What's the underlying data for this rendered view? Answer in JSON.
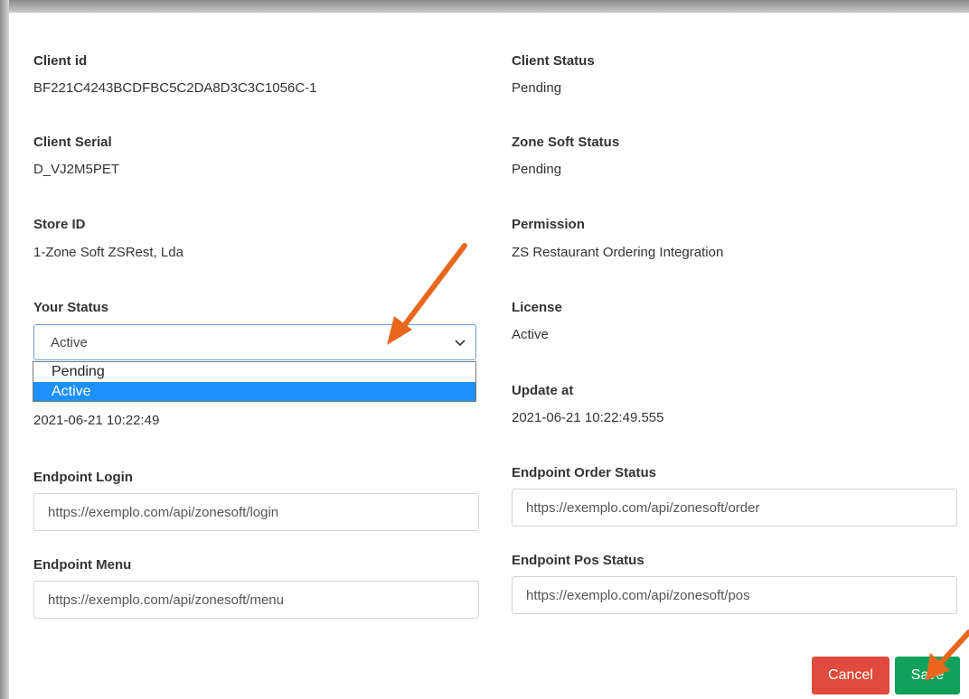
{
  "fields": {
    "client_id": {
      "label": "Client id",
      "value": "BF221C4243BCDFBC5C2DA8D3C3C1056C-1"
    },
    "client_status": {
      "label": "Client Status",
      "value": "Pending"
    },
    "client_serial": {
      "label": "Client Serial",
      "value": "D_VJ2M5PET"
    },
    "zone_soft_status": {
      "label": "Zone Soft Status",
      "value": "Pending"
    },
    "store_id": {
      "label": "Store ID",
      "value": "1-Zone Soft ZSRest, Lda"
    },
    "permission": {
      "label": "Permission",
      "value": "ZS Restaurant Ordering Integration"
    },
    "license": {
      "label": "License",
      "value": "Active"
    },
    "created_at": {
      "value": "2021-06-21 10:22:49"
    },
    "update_at": {
      "label": "Update at",
      "value": "2021-06-21 10:22:49.555"
    }
  },
  "your_status": {
    "label": "Your Status",
    "selected": "Active",
    "options": [
      "Pending",
      "Active"
    ]
  },
  "endpoints": {
    "login": {
      "label": "Endpoint Login",
      "value": "https://exemplo.com/api/zonesoft/login"
    },
    "order_status": {
      "label": "Endpoint Order Status",
      "value": "https://exemplo.com/api/zonesoft/order"
    },
    "menu": {
      "label": "Endpoint Menu",
      "value": "https://exemplo.com/api/zonesoft/menu"
    },
    "pos_status": {
      "label": "Endpoint Pos Status",
      "value": "https://exemplo.com/api/zonesoft/pos"
    }
  },
  "buttons": {
    "cancel": "Cancel",
    "save": "Save"
  },
  "colors": {
    "cancel": "#df4b3c",
    "save": "#0fa15a",
    "selected_option": "#1e90ff",
    "annotation_arrow": "#e8671c"
  },
  "icons": {
    "select_chevron": "chevron-down-icon",
    "annotation": "arrow-annotation-icon"
  }
}
